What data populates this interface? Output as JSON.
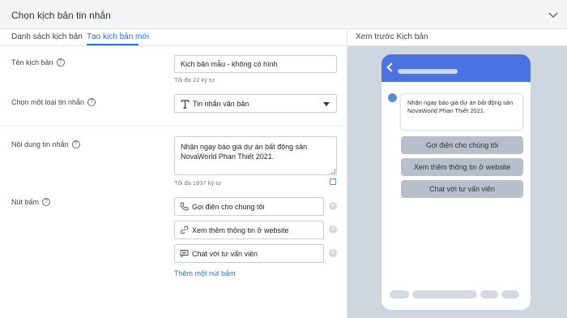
{
  "header": {
    "title": "Chọn kịch bản tin nhắn",
    "chevron_icon": "chevron-down-icon"
  },
  "tabs": [
    {
      "label": "Danh sách kịch bản",
      "active": false
    },
    {
      "label": "Tạo kịch bản mới",
      "active": true
    }
  ],
  "preview": {
    "header": "Xem trước Kịch bản",
    "message": "Nhận ngay báo giá dự án bất động sản NovaWorld Phan Thiết 2021.",
    "buttons": [
      "Gọi điện cho chúng tôi",
      "Xem thêm thông tin ở website",
      "Chat với tư vấn viên"
    ]
  },
  "form": {
    "name": {
      "label": "Tên kịch bản",
      "value": "Kịch bản mẫu - không có hình",
      "hint": "Tối đa 22 ký tự"
    },
    "type": {
      "label": "Chọn một loại tin nhắn",
      "value": "Tin nhắn văn bản"
    },
    "content": {
      "label": "Nội dung tin nhắn",
      "value": "Nhận ngay báo giá dự án bất động sản NovaWorld Phan Thiết 2021.",
      "hint": "Tối đa 1937 ký tự"
    },
    "buttons": {
      "label": "Nút bấm",
      "items": [
        {
          "label": "Gọi điện cho chúng tôi",
          "icon": "phone-icon"
        },
        {
          "label": "Xem thêm thông tin ở website",
          "icon": "link-icon"
        },
        {
          "label": "Chat với tư vấn viên",
          "icon": "chat-icon"
        }
      ],
      "add_label": "Thêm một nút bấm"
    }
  },
  "colors": {
    "accent": "#1a73e8",
    "phone_header": "#4a72e0",
    "preview_bg": "#cfd6df",
    "preview_button": "#b7bfca"
  }
}
